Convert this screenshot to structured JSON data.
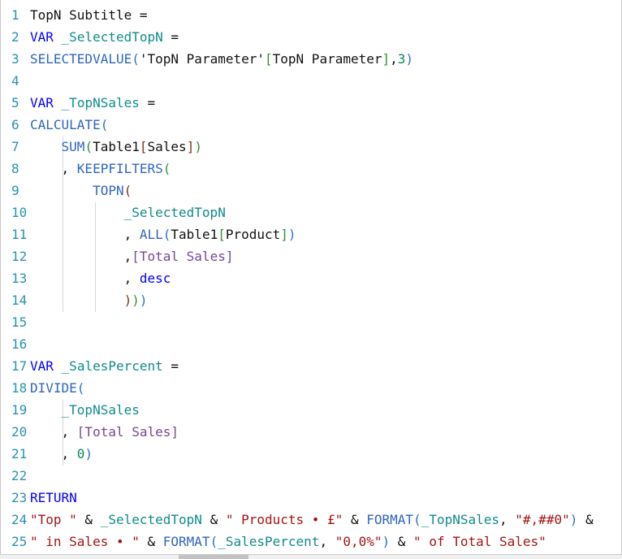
{
  "editor": {
    "lines": [
      {
        "num": "1",
        "tokens": [
          {
            "t": "TopN Subtitle =",
            "c": "t"
          }
        ]
      },
      {
        "num": "2",
        "tokens": [
          {
            "t": "VAR",
            "c": "k"
          },
          {
            "t": " ",
            "c": "t"
          },
          {
            "t": "_SelectedTopN",
            "c": "v"
          },
          {
            "t": " =",
            "c": "t"
          }
        ]
      },
      {
        "num": "3",
        "tokens": [
          {
            "t": "SELECTEDVALUE",
            "c": "f"
          },
          {
            "t": "(",
            "c": "p1"
          },
          {
            "t": "'TopN Parameter'",
            "c": "t"
          },
          {
            "t": "[",
            "c": "p2"
          },
          {
            "t": "TopN Parameter",
            "c": "t"
          },
          {
            "t": "]",
            "c": "p2"
          },
          {
            "t": ",",
            "c": "t"
          },
          {
            "t": "3",
            "c": "n"
          },
          {
            "t": ")",
            "c": "p1"
          }
        ]
      },
      {
        "num": "4",
        "tokens": []
      },
      {
        "num": "5",
        "tokens": [
          {
            "t": "VAR",
            "c": "k"
          },
          {
            "t": " ",
            "c": "t"
          },
          {
            "t": "_TopNSales",
            "c": "v"
          },
          {
            "t": " =",
            "c": "t"
          }
        ]
      },
      {
        "num": "6",
        "tokens": [
          {
            "t": "CALCULATE",
            "c": "f"
          },
          {
            "t": "(",
            "c": "p1"
          }
        ]
      },
      {
        "num": "7",
        "tokens": [
          {
            "t": "    ",
            "c": "t"
          },
          {
            "t": "SUM",
            "c": "f"
          },
          {
            "t": "(",
            "c": "p2"
          },
          {
            "t": "Table1",
            "c": "t"
          },
          {
            "t": "[",
            "c": "p3"
          },
          {
            "t": "Sales",
            "c": "t"
          },
          {
            "t": "]",
            "c": "p3"
          },
          {
            "t": ")",
            "c": "p2"
          }
        ]
      },
      {
        "num": "8",
        "tokens": [
          {
            "t": "    , ",
            "c": "t"
          },
          {
            "t": "KEEPFILTERS",
            "c": "f"
          },
          {
            "t": "(",
            "c": "p2"
          }
        ]
      },
      {
        "num": "9",
        "tokens": [
          {
            "t": "        ",
            "c": "t"
          },
          {
            "t": "TOPN",
            "c": "f"
          },
          {
            "t": "(",
            "c": "p3"
          }
        ]
      },
      {
        "num": "10",
        "tokens": [
          {
            "t": "            ",
            "c": "t"
          },
          {
            "t": "_SelectedTopN",
            "c": "v"
          }
        ]
      },
      {
        "num": "11",
        "tokens": [
          {
            "t": "            , ",
            "c": "t"
          },
          {
            "t": "ALL",
            "c": "f"
          },
          {
            "t": "(",
            "c": "p1"
          },
          {
            "t": "Table1",
            "c": "t"
          },
          {
            "t": "[",
            "c": "p2"
          },
          {
            "t": "Product",
            "c": "t"
          },
          {
            "t": "]",
            "c": "p2"
          },
          {
            "t": ")",
            "c": "p1"
          }
        ]
      },
      {
        "num": "12",
        "tokens": [
          {
            "t": "            ,",
            "c": "t"
          },
          {
            "t": "[Total Sales]",
            "c": "m"
          }
        ]
      },
      {
        "num": "13",
        "tokens": [
          {
            "t": "            , ",
            "c": "t"
          },
          {
            "t": "desc",
            "c": "k"
          }
        ]
      },
      {
        "num": "14",
        "tokens": [
          {
            "t": "            ",
            "c": "t"
          },
          {
            "t": ")",
            "c": "p3"
          },
          {
            "t": ")",
            "c": "p2"
          },
          {
            "t": ")",
            "c": "p1"
          }
        ]
      },
      {
        "num": "15",
        "tokens": []
      },
      {
        "num": "16",
        "tokens": []
      },
      {
        "num": "17",
        "tokens": [
          {
            "t": "VAR",
            "c": "k"
          },
          {
            "t": " ",
            "c": "t"
          },
          {
            "t": "_SalesPercent",
            "c": "v"
          },
          {
            "t": " =",
            "c": "t"
          }
        ]
      },
      {
        "num": "18",
        "tokens": [
          {
            "t": "DIVIDE",
            "c": "f"
          },
          {
            "t": "(",
            "c": "p1"
          }
        ]
      },
      {
        "num": "19",
        "tokens": [
          {
            "t": "    ",
            "c": "t"
          },
          {
            "t": "_TopNSales",
            "c": "v"
          }
        ]
      },
      {
        "num": "20",
        "tokens": [
          {
            "t": "    , ",
            "c": "t"
          },
          {
            "t": "[Total Sales]",
            "c": "m"
          }
        ]
      },
      {
        "num": "21",
        "tokens": [
          {
            "t": "    , ",
            "c": "t"
          },
          {
            "t": "0",
            "c": "n"
          },
          {
            "t": ")",
            "c": "p1"
          }
        ]
      },
      {
        "num": "22",
        "tokens": []
      },
      {
        "num": "23",
        "tokens": [
          {
            "t": "RETURN",
            "c": "k"
          }
        ]
      },
      {
        "num": "24",
        "tokens": [
          {
            "t": "\"Top \"",
            "c": "s"
          },
          {
            "t": " & ",
            "c": "t"
          },
          {
            "t": "_SelectedTopN",
            "c": "v"
          },
          {
            "t": " & ",
            "c": "t"
          },
          {
            "t": "\" Products • £\"",
            "c": "s"
          },
          {
            "t": " & ",
            "c": "t"
          },
          {
            "t": "FORMAT",
            "c": "f"
          },
          {
            "t": "(",
            "c": "p1"
          },
          {
            "t": "_TopNSales",
            "c": "v"
          },
          {
            "t": ", ",
            "c": "t"
          },
          {
            "t": "\"#,##0\"",
            "c": "s"
          },
          {
            "t": ")",
            "c": "p1"
          },
          {
            "t": " &",
            "c": "t"
          }
        ]
      },
      {
        "num": "25",
        "tokens": [
          {
            "t": "\" in Sales • \"",
            "c": "s"
          },
          {
            "t": " & ",
            "c": "t"
          },
          {
            "t": "FORMAT",
            "c": "f"
          },
          {
            "t": "(",
            "c": "p1"
          },
          {
            "t": "_SalesPercent",
            "c": "v"
          },
          {
            "t": ", ",
            "c": "t"
          },
          {
            "t": "\"0,0%\"",
            "c": "s"
          },
          {
            "t": ")",
            "c": "p1"
          },
          {
            "t": " & ",
            "c": "t"
          },
          {
            "t": "\" of Total Sales\"",
            "c": "s"
          }
        ]
      }
    ]
  }
}
